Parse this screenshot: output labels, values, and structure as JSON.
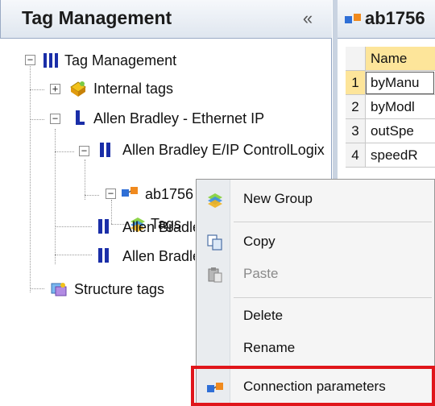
{
  "left_panel": {
    "title": "Tag Management",
    "collapse_glyph": "«",
    "tree": {
      "root": {
        "label": "Tag Management",
        "icon": "tag-management-icon",
        "expander": "−"
      },
      "internal_tags": {
        "label": "Internal tags",
        "icon": "internal-tags-icon",
        "expander": "+"
      },
      "allen_bradley_ethernet_ip": {
        "label": "Allen Bradley - Ethernet IP",
        "icon": "channel-icon",
        "expander": "−"
      },
      "controllogix": {
        "label": "Allen Bradley E/IP ControlLogix",
        "icon": "driver-icon",
        "expander": "−"
      },
      "ab1756": {
        "label": "ab1756",
        "icon": "connection-icon",
        "expander": "−"
      },
      "tags_child": {
        "label": "Tags",
        "icon": "tag-table-icon"
      },
      "allen_bra_1": {
        "label": "Allen Bradley",
        "icon": "driver-icon"
      },
      "allen_bra_2": {
        "label": "Allen Bradley",
        "icon": "driver-icon"
      },
      "structure_tags": {
        "label": "Structure tags",
        "icon": "structure-tags-icon"
      }
    }
  },
  "right_panel": {
    "tab_label": "ab1756",
    "tab_icon": "connection-icon",
    "column_header": "Name",
    "rows": [
      {
        "num": "1",
        "name": "byManu"
      },
      {
        "num": "2",
        "name": "byModl"
      },
      {
        "num": "3",
        "name": "outSpe"
      },
      {
        "num": "4",
        "name": "speedR"
      }
    ]
  },
  "context_menu": {
    "items": [
      {
        "label": "New Group",
        "icon": "new-group-icon"
      },
      {
        "label": "Copy",
        "icon": "copy-icon"
      },
      {
        "label": "Paste",
        "icon": "paste-icon",
        "disabled": true
      },
      {
        "label": "Delete"
      },
      {
        "label": "Rename"
      },
      {
        "label": "Connection parameters",
        "icon": "connection-icon"
      }
    ]
  },
  "colors": {
    "highlight_red": "#e0161b",
    "header_yellow": "#fde59a",
    "panel_gradient_top": "#f6f8fb",
    "panel_gradient_bottom": "#dfe6ef"
  }
}
